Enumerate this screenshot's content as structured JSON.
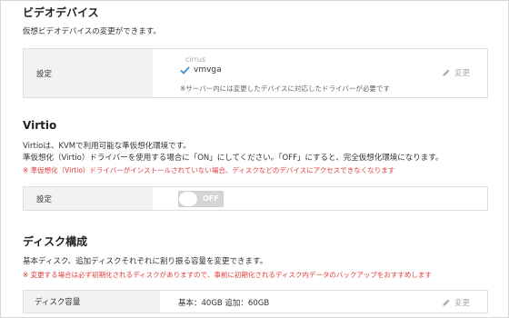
{
  "video": {
    "title": "ビデオデバイス",
    "description": "仮想ビデオデバイスの変更ができます。",
    "setting_label": "設定",
    "option_inactive": "cirrus",
    "option_active": "vmvga",
    "note": "※サーバー内には変更したデバイスに対応したドライバーが必要です",
    "edit_label": "変更"
  },
  "virtio": {
    "title": "Virtio",
    "description_line1": "Virtioは、KVMで利用可能な準仮想化環境です。",
    "description_line2": "準仮想化（Virtio）ドライバーを使用する場合に「ON」にしてください。「OFF」にすると、完全仮想化環境になります。",
    "warning": "※ 準仮想化（Virtio）ドライバーがインストールされていない場合、ディスクなどのデバイスにアクセスできなくなります",
    "setting_label": "設定",
    "toggle_state": "OFF"
  },
  "disk": {
    "title": "ディスク構成",
    "description": "基本ディスク、追加ディスクそれぞれに割り振る容量を変更できます。",
    "warning": "※ 変更する場合は必ず初期化されるディスクがありますので、事前に初期化されるディスク内データのバックアップをおすすめします",
    "capacity_label": "ディスク容量",
    "capacity_value": "基本：40GB 追加：60GB",
    "edit_label": "変更"
  },
  "colors": {
    "accent_check": "#3a8fd6",
    "warning": "#e23b3b",
    "label_bg": "#f2f2f2",
    "toggle_off": "#d5d5d5"
  }
}
